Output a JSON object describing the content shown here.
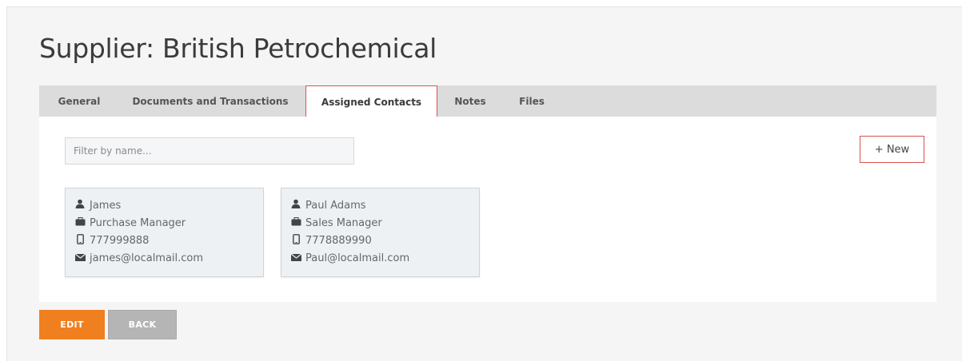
{
  "page": {
    "title": "Supplier: British Petrochemical"
  },
  "tabs": [
    {
      "label": "General"
    },
    {
      "label": "Documents and Transactions"
    },
    {
      "label": "Assigned Contacts"
    },
    {
      "label": "Notes"
    },
    {
      "label": "Files"
    }
  ],
  "active_tab": "Assigned Contacts",
  "filter": {
    "placeholder": "Filter by name...",
    "value": ""
  },
  "new_button": {
    "label": "+ New"
  },
  "contacts": [
    {
      "name": "James",
      "role": "Purchase Manager",
      "phone": "777999888",
      "email": "james@localmail.com"
    },
    {
      "name": "Paul Adams",
      "role": "Sales Manager",
      "phone": "7778889990",
      "email": "Paul@localmail.com"
    }
  ],
  "icons": {
    "name": "user-icon",
    "role": "briefcase-icon",
    "phone": "mobile-phone-icon",
    "email": "envelope-icon"
  },
  "actions": {
    "edit_label": "EDIT",
    "back_label": "BACK"
  },
  "colors": {
    "accent_orange": "#f07f1f",
    "highlight_red": "#d9534f",
    "back_gray": "#b5b5b5",
    "tabbar_gray": "#dcdcdc"
  }
}
